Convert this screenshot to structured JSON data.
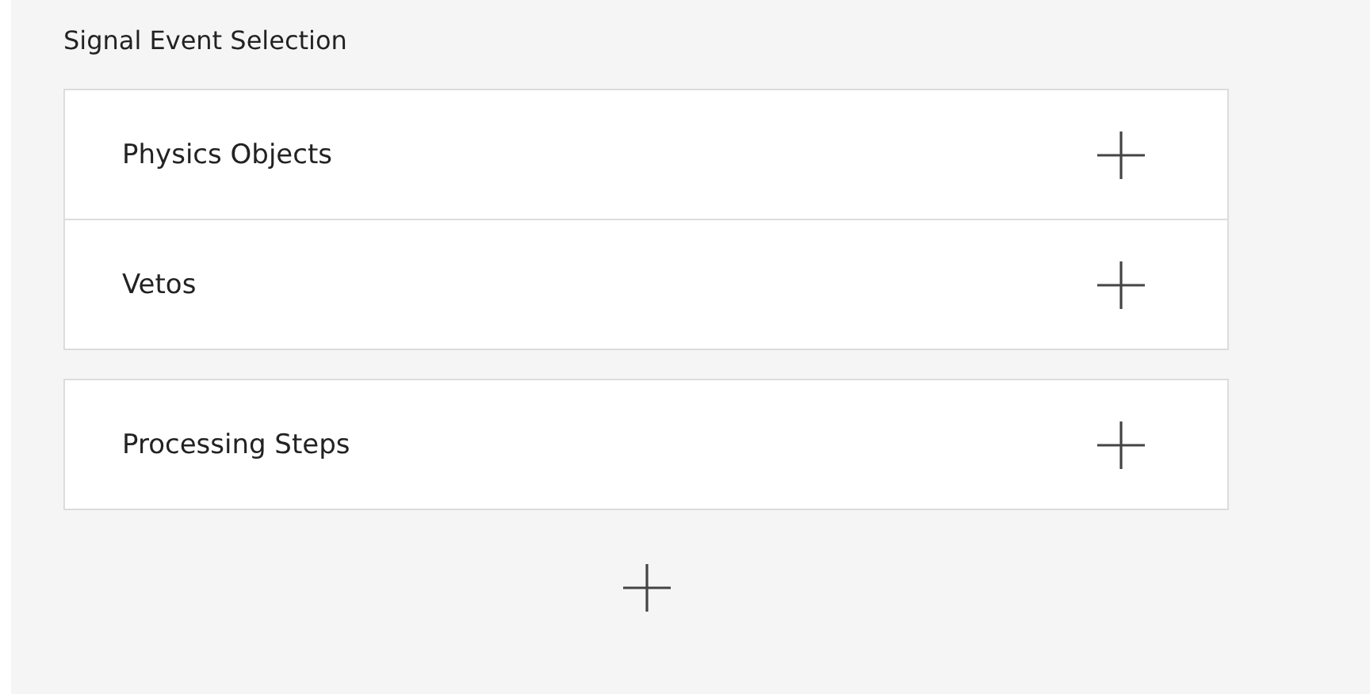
{
  "title": "Signal Event Selection",
  "groups": [
    {
      "items": [
        {
          "label": "Physics Objects"
        },
        {
          "label": "Vetos"
        }
      ]
    },
    {
      "items": [
        {
          "label": "Processing Steps"
        }
      ]
    }
  ]
}
